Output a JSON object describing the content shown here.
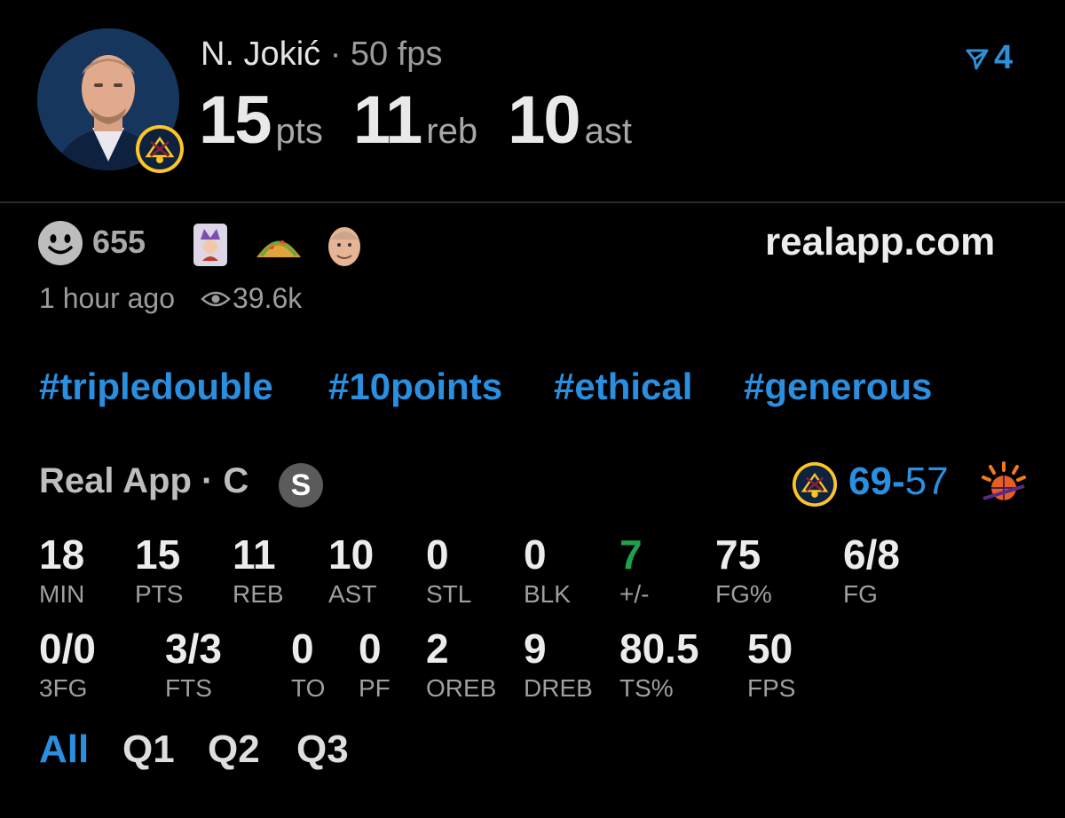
{
  "header": {
    "player_name": "N. Jokić",
    "separator": "·",
    "fps_label": "50 fps",
    "stats": [
      {
        "value": "15",
        "unit": "pts"
      },
      {
        "value": "11",
        "unit": "reb"
      },
      {
        "value": "10",
        "unit": "ast"
      }
    ],
    "share_count": "4"
  },
  "reactions": {
    "count": "655",
    "site": "realapp.com",
    "time_ago": "1 hour ago",
    "views": "39.6k"
  },
  "hashtags": [
    "#tripledouble",
    "#10points",
    "#ethical",
    "#generous"
  ],
  "game": {
    "title": "Real App · C",
    "badge": "S",
    "home_score": "69",
    "dash": "-",
    "away_score": "57"
  },
  "stats_row1": [
    {
      "value": "18",
      "label": "MIN"
    },
    {
      "value": "15",
      "label": "PTS"
    },
    {
      "value": "11",
      "label": "REB"
    },
    {
      "value": "10",
      "label": "AST"
    },
    {
      "value": "0",
      "label": "STL"
    },
    {
      "value": "0",
      "label": "BLK"
    },
    {
      "value": "7",
      "label": "+/-"
    },
    {
      "value": "75",
      "label": "FG%"
    },
    {
      "value": "6/8",
      "label": "FG"
    }
  ],
  "stats_row2": [
    {
      "value": "0/0",
      "label": "3FG"
    },
    {
      "value": "3/3",
      "label": "FTS"
    },
    {
      "value": "0",
      "label": "TO"
    },
    {
      "value": "0",
      "label": "PF"
    },
    {
      "value": "2",
      "label": "OREB"
    },
    {
      "value": "9",
      "label": "DREB"
    },
    {
      "value": "80.5",
      "label": "TS%"
    },
    {
      "value": "50",
      "label": "FPS"
    }
  ],
  "tabs": [
    "All",
    "Q1",
    "Q2",
    "Q3"
  ],
  "colors": {
    "accent": "#2a8fe0",
    "positive": "#1fa04a",
    "nuggets_navy": "#0e2240",
    "nuggets_gold": "#fec524"
  }
}
